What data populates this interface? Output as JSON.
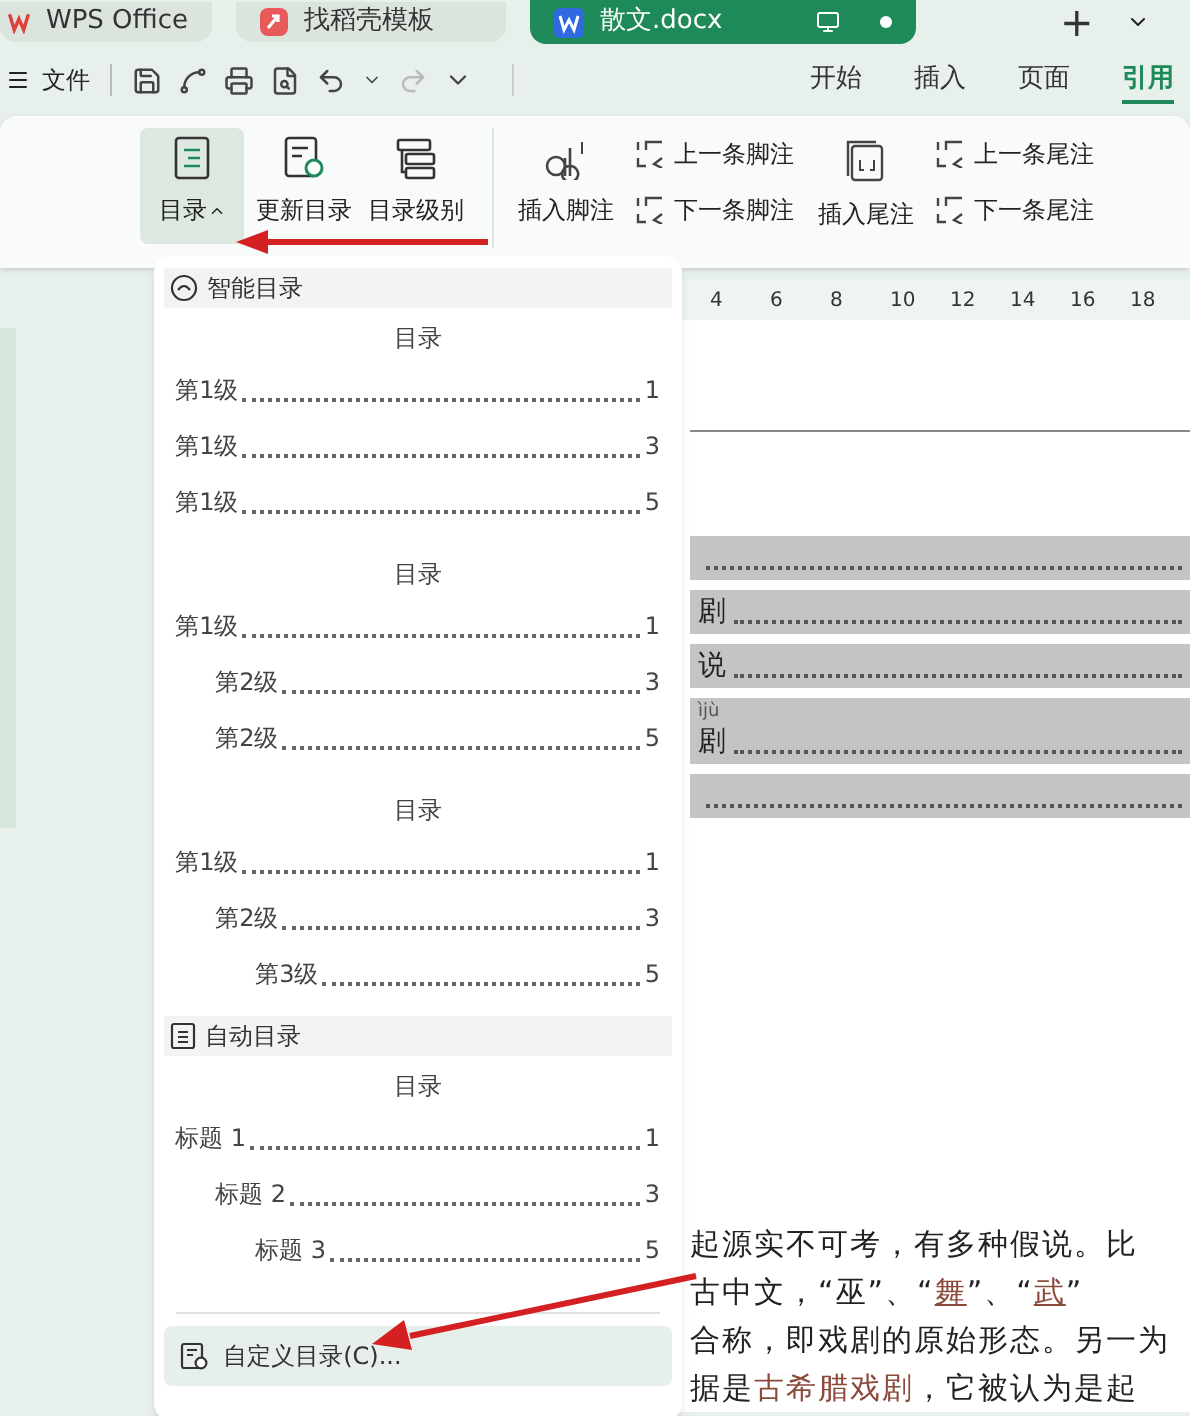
{
  "tabs": [
    {
      "label": "WPS Office",
      "kind": "wps",
      "selected": false
    },
    {
      "label": "找稻壳模板",
      "kind": "template",
      "selected": false
    },
    {
      "label": "散文.docx",
      "kind": "doc",
      "selected": true
    }
  ],
  "new_tab": "+",
  "file_menu": "文件",
  "ribbon_tabs": [
    {
      "label": "开始",
      "selected": false
    },
    {
      "label": "插入",
      "selected": false
    },
    {
      "label": "页面",
      "selected": false
    },
    {
      "label": "引用",
      "selected": true
    }
  ],
  "ribbon": {
    "toc_buttons": [
      {
        "label": "目录",
        "kind": "toc",
        "selected": true
      },
      {
        "label": "更新目录",
        "kind": "update",
        "selected": false
      },
      {
        "label": "目录级别",
        "kind": "level",
        "selected": false
      }
    ],
    "insert_footnote": "插入脚注",
    "footnote_nav": [
      "上一条脚注",
      "下一条脚注"
    ],
    "insert_endnote": "插入尾注",
    "endnote_nav": [
      "上一条尾注",
      "下一条尾注"
    ]
  },
  "toc_menu": {
    "sections": [
      {
        "title": "智能目录",
        "kind": "smart",
        "previews": [
          {
            "title": "目录",
            "entries": [
              {
                "label": "第1级",
                "page": "1"
              },
              {
                "label": "第1级",
                "page": "3"
              },
              {
                "label": "第1级",
                "page": "5"
              }
            ]
          },
          {
            "title": "目录",
            "entries": [
              {
                "label": "第1级",
                "page": "1",
                "children": [
                  {
                    "label": "第2级",
                    "page": "3"
                  },
                  {
                    "label": "第2级",
                    "page": "5"
                  }
                ]
              }
            ]
          },
          {
            "title": "目录",
            "entries": [
              {
                "label": "第1级",
                "page": "1",
                "children": [
                  {
                    "label": "第2级",
                    "page": "3",
                    "children": [
                      {
                        "label": "第3级",
                        "page": "5"
                      }
                    ]
                  }
                ]
              }
            ]
          }
        ]
      },
      {
        "title": "自动目录",
        "kind": "auto",
        "previews": [
          {
            "title": "目录",
            "entries": [
              {
                "label": "标题 1",
                "page": "1",
                "children": [
                  {
                    "label": "标题 2",
                    "page": "3",
                    "children": [
                      {
                        "label": "标题 3",
                        "page": "5"
                      }
                    ]
                  }
                ]
              }
            ]
          }
        ]
      }
    ],
    "custom_button": "自定义目录(C)..."
  },
  "document": {
    "ruler": [
      "4",
      "6",
      "8",
      "10",
      "12",
      "14",
      "16",
      "18"
    ],
    "toc_rows": [
      {},
      {
        "text": "剧"
      },
      {
        "text": "说"
      },
      {
        "text": "剧",
        "pinyin": "ìjù"
      },
      {}
    ],
    "paragraph": [
      [
        {
          "text": "起源实不可考，有多种假说。比",
          "kind": "plain"
        }
      ],
      [
        {
          "text": "古中文，“巫”、“",
          "kind": "plain"
        },
        {
          "text": "舞",
          "kind": "underlined"
        },
        {
          "text": "”、“",
          "kind": "plain"
        },
        {
          "text": "武",
          "kind": "underlined"
        },
        {
          "text": "”",
          "kind": "plain"
        }
      ],
      [
        {
          "text": "合称，即戏剧的原始形态。另一为",
          "kind": "plain"
        }
      ],
      [
        {
          "text": "据是",
          "kind": "plain"
        },
        {
          "text": "古希腊戏剧",
          "kind": "colored"
        },
        {
          "text": "，它被认为是起",
          "kind": "plain"
        }
      ]
    ]
  }
}
